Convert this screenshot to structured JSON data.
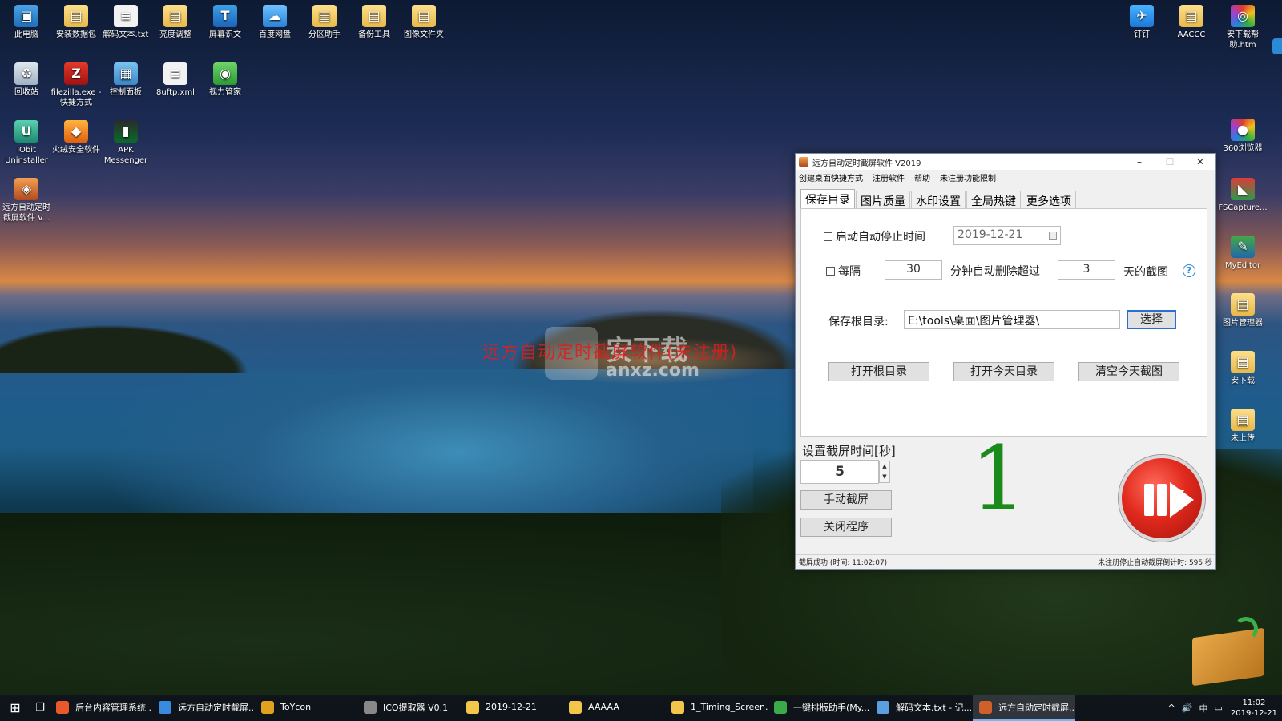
{
  "desktop": {
    "icons": [
      {
        "label": "此电脑",
        "glyph": "▣"
      },
      {
        "label": "安装数据包",
        "glyph": "▤"
      },
      {
        "label": "解码文本.txt",
        "glyph": "≡"
      },
      {
        "label": "亮度调整",
        "glyph": "▤"
      },
      {
        "label": "屏幕识文",
        "glyph": "T"
      },
      {
        "label": "百度网盘",
        "glyph": "☁"
      },
      {
        "label": "分区助手",
        "glyph": "▤"
      },
      {
        "label": "备份工具",
        "glyph": "▤"
      },
      {
        "label": "图像文件夹",
        "glyph": "▤"
      },
      {
        "label": "回收站",
        "glyph": "♻"
      },
      {
        "label": "filezilla.exe - 快捷方式",
        "glyph": "Z"
      },
      {
        "label": "控制面板",
        "glyph": "▦"
      },
      {
        "label": "8uftp.xml",
        "glyph": "≡"
      },
      {
        "label": "视力管家",
        "glyph": "◉"
      },
      {
        "label": "IObit Uninstaller",
        "glyph": "U"
      },
      {
        "label": "火绒安全软件",
        "glyph": "◆"
      },
      {
        "label": "APK Messenger",
        "glyph": "▮"
      },
      {
        "label": "远方自动定时截屏软件 V...",
        "glyph": "◈"
      },
      {
        "label": "钉钉",
        "glyph": "✈"
      },
      {
        "label": "AACCC",
        "glyph": "▤"
      },
      {
        "label": "安下载帮助.htm",
        "glyph": "◎"
      },
      {
        "label": "360浏览器",
        "glyph": "●"
      },
      {
        "label": "FSCapture...",
        "glyph": "◣"
      },
      {
        "label": "MyEditor",
        "glyph": "✎"
      },
      {
        "label": "图片管理器",
        "glyph": "▤"
      },
      {
        "label": "安下载",
        "glyph": "▤"
      },
      {
        "label": "未上传",
        "glyph": "▤"
      }
    ]
  },
  "watermark": {
    "text": "远方自动定时截屏软件(未注册)",
    "site_name": "安下载",
    "site_url": "anxz.com"
  },
  "window": {
    "title": "远方自动定时截屏软件 V2019",
    "controls": {
      "minimize": "–",
      "maximize": "☐",
      "close": "✕"
    },
    "menu": [
      "创建桌面快捷方式",
      "注册软件",
      "帮助",
      "未注册功能限制"
    ],
    "tabs": [
      "保存目录",
      "图片质量",
      "水印设置",
      "全局热键",
      "更多选项"
    ],
    "active_tab": 0,
    "save_tab": {
      "auto_stop_label": "启动自动停止时间",
      "auto_stop_checked": false,
      "auto_stop_date": "2019-12-21",
      "every_label": "每隔",
      "every_checked": false,
      "every_minutes": "30",
      "delete_label": "分钟自动删除超过",
      "delete_days": "3",
      "days_label": "天的截图",
      "help": "?",
      "root_label": "保存根目录:",
      "root_path": "E:\\tools\\桌面\\图片管理器\\",
      "choose_button": "选择",
      "open_root_button": "打开根目录",
      "open_today_button": "打开今天目录",
      "clear_today_button": "清空今天截图"
    },
    "interval_label": "设置截屏时间[秒]",
    "interval_value": "5",
    "manual_button": "手动截屏",
    "close_button": "关闭程序",
    "countdown": "1",
    "status_left": "截屏成功 (时间: 11:02:07)",
    "status_right": "未注册停止自动截屏倒计时: 595 秒"
  },
  "taskbar": {
    "items": [
      {
        "label": "后台内容管理系统 ...",
        "color": "#e8582a",
        "active": false
      },
      {
        "label": "远方自动定时截屏...",
        "color": "#3a8ae0",
        "active": false
      },
      {
        "label": "ToYcon",
        "color": "#e0a020",
        "active": false
      },
      {
        "label": "ICO提取器 V0.1",
        "color": "#888888",
        "active": false
      },
      {
        "label": "2019-12-21",
        "color": "#f2c64a",
        "active": false
      },
      {
        "label": "AAAAA",
        "color": "#f2c64a",
        "active": false
      },
      {
        "label": "1_Timing_Screen...",
        "color": "#f2c64a",
        "active": false
      },
      {
        "label": "一键排版助手(My...",
        "color": "#3aaa4a",
        "active": false
      },
      {
        "label": "解码文本.txt - 记...",
        "color": "#5aa0e0",
        "active": false
      },
      {
        "label": "远方自动定时截屏...",
        "color": "#d0602a",
        "active": true
      }
    ],
    "tray": {
      "chevron": "^",
      "volume": "🔊",
      "ime": "中",
      "notify": "▭"
    },
    "time": "11:02",
    "date": "2019-12-21"
  }
}
